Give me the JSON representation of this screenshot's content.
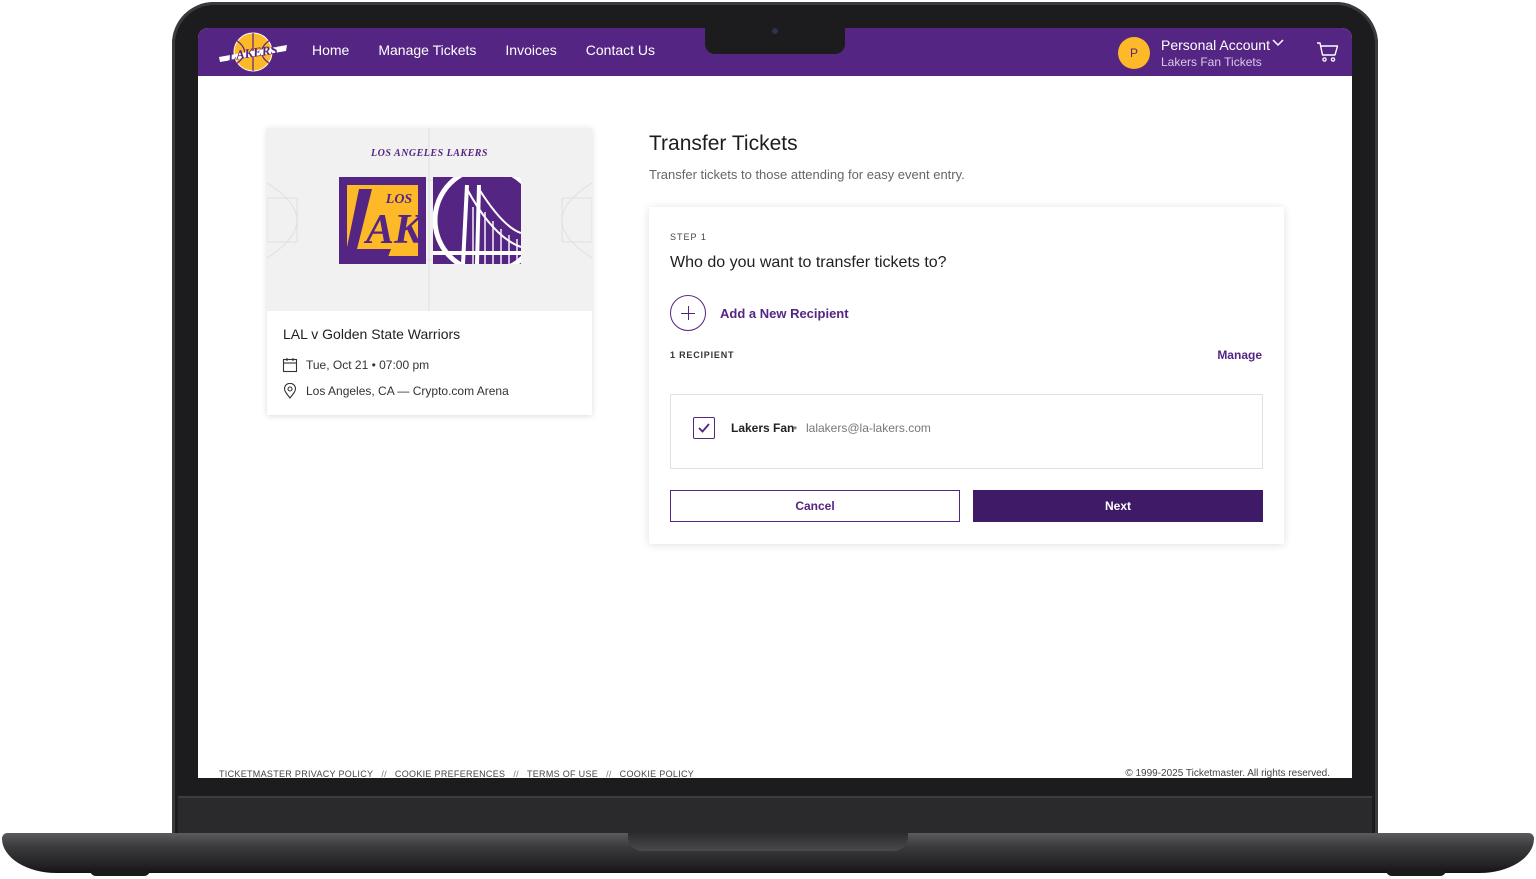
{
  "nav": {
    "links": [
      "Home",
      "Manage Tickets",
      "Invoices",
      "Contact Us"
    ],
    "account": {
      "initial": "P",
      "name": "Personal Account",
      "subtitle": "Lakers Fan Tickets"
    },
    "logo_alt": "LAKERS"
  },
  "event": {
    "art_title": "LOS ANGELES LAKERS",
    "name": "LAL v Golden State Warriors",
    "date": "Tue, Oct 21 • 07:00 pm",
    "location": "Los Angeles, CA — Crypto.com Arena"
  },
  "transfer": {
    "title": "Transfer Tickets",
    "subtitle": "Transfer tickets to those attending for easy event entry.",
    "step_label": "STEP 1",
    "question": "Who do you want to transfer tickets to?",
    "add_recipient_label": "Add a New Recipient",
    "recipient_count": "1 RECIPIENT",
    "manage_label": "Manage",
    "recipients": [
      {
        "name": "Lakers Fan",
        "email": "lalakers@la-lakers.com",
        "checked": true
      }
    ],
    "cancel_label": "Cancel",
    "next_label": "Next"
  },
  "footer": {
    "links": [
      "TICKETMASTER PRIVACY POLICY",
      "COOKIE PREFERENCES",
      "TERMS OF USE",
      "COOKIE POLICY"
    ],
    "separator": "//",
    "copyright": "© 1999-2025 Ticketmaster. All rights reserved."
  },
  "colors": {
    "brand_purple": "#552583",
    "brand_gold": "#fdb927",
    "button_dark": "#3f1a66"
  }
}
